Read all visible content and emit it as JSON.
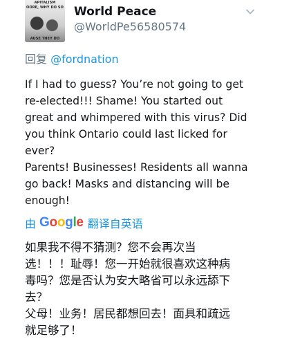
{
  "author": {
    "display_name": "World Peace",
    "handle": "@WorldPe56580574",
    "avatar_caption": [
      "APITALISM",
      "OORE, WHY DO SO",
      "AUSE THEY DO"
    ]
  },
  "reply": {
    "prefix": "回复",
    "mention": "@fordnation"
  },
  "tweet": {
    "lines": [
      "If I had to guess? You’re not going to get",
      "re-elected!!! Shame! You started out",
      "great and whimpered with this virus? Did",
      "you think Ontario could last licked for",
      "ever?",
      "Parents! Businesses! Residents all wanna",
      "go back! Masks and distancing will be",
      "enough!"
    ]
  },
  "translate": {
    "by": "由",
    "google_letters": [
      "G",
      "o",
      "o",
      "g",
      "l",
      "e"
    ],
    "from": "翻译自英语"
  },
  "translation": {
    "lines": [
      "如果我不得不猜测？您不会再次当",
      "选！！！耻辱！您一开始就很喜欢这种病",
      "毒吗？您是否认为安大略省可以永远舔下",
      "去？",
      "父母！业务！居民都想回去！面具和疏远",
      "就足够了！"
    ]
  },
  "colors": {
    "link": "#1b95e0",
    "muted": "#657786",
    "text": "#14171a"
  },
  "icons": {
    "menu": "chevron-down-icon"
  }
}
